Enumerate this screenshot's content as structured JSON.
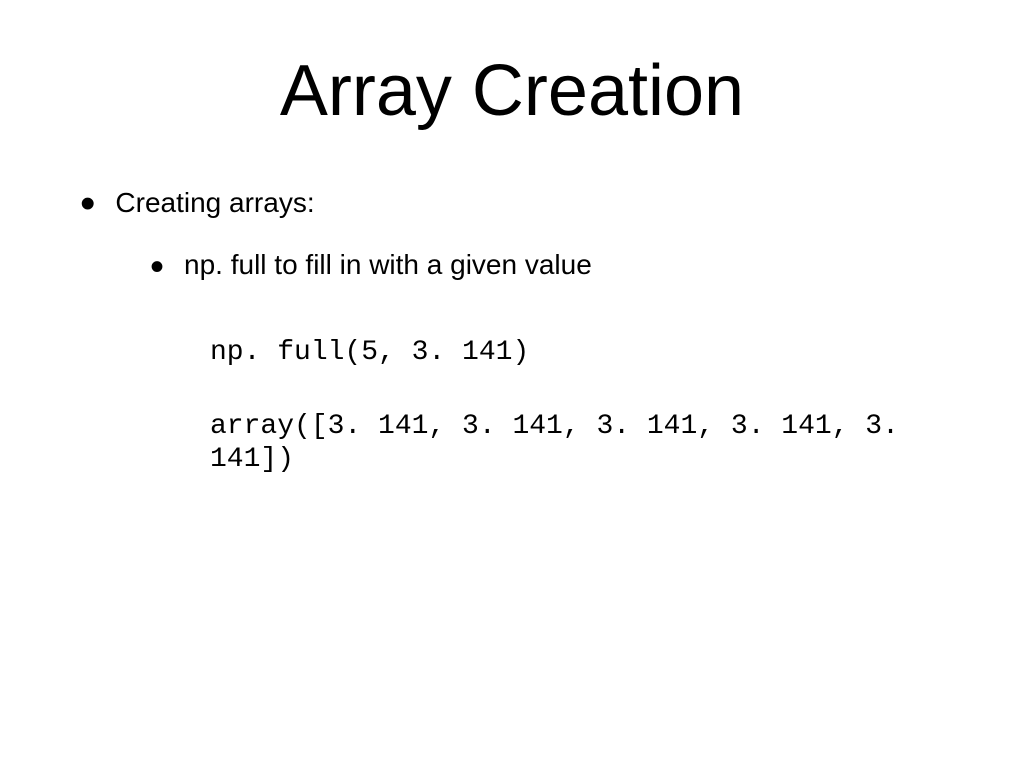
{
  "title": "Array Creation",
  "bullet1": "Creating arrays:",
  "bullet2": "np. full to fill in with a given value",
  "code": {
    "line1": "np. full(5, 3. 141)",
    "line2": "array([3. 141, 3. 141, 3. 141, 3. 141, 3. 141])"
  }
}
